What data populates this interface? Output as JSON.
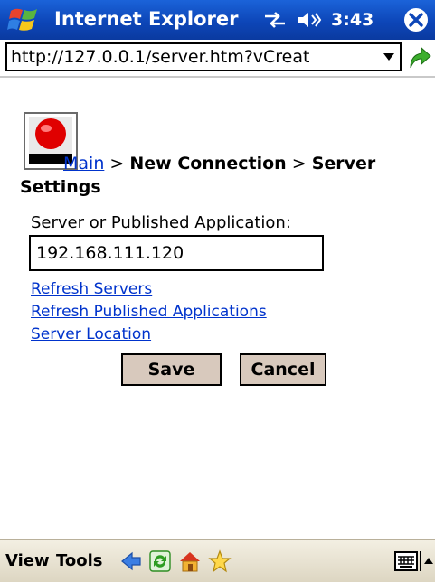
{
  "titlebar": {
    "app_title": "Internet Explorer",
    "time": "3:43",
    "icons": [
      "windows-flag-icon",
      "connectivity-icon",
      "volume-icon",
      "close-icon"
    ]
  },
  "addressbar": {
    "url": "http://127.0.0.1/server.htm?vCreat"
  },
  "content": {
    "breadcrumb": {
      "main_link": "Main",
      "sep1": " > ",
      "step1": "New Connection",
      "sep2": " > ",
      "step2": "Server Settings"
    },
    "field_label": "Server or Published Application:",
    "server_value": "192.168.111.120",
    "links": {
      "refresh_servers": "Refresh Servers",
      "refresh_published": "Refresh Published Applications",
      "server_location": "Server Location"
    },
    "buttons": {
      "save": "Save",
      "cancel": "Cancel"
    }
  },
  "menubar": {
    "view": "View",
    "tools": "Tools",
    "icons": [
      "back-icon",
      "refresh-icon",
      "home-icon",
      "favorites-icon",
      "keyboard-icon"
    ]
  },
  "colors": {
    "titlebar": "#0d46b8",
    "link": "#0033cc",
    "button_bg": "#d8c9bd",
    "menubar_bg": "#e9e3d2"
  }
}
